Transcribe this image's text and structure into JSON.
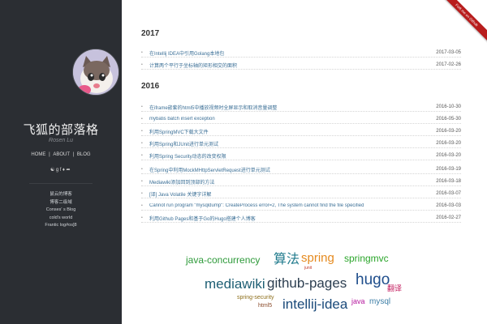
{
  "sidebar": {
    "title": "飞狐的部落格",
    "subtitle": "Rosen Lu",
    "nav": [
      "HOME",
      "ABOUT",
      "BLOG"
    ],
    "social_icons": [
      "github-icon",
      "google-plus-icon",
      "facebook-icon",
      "twitter-icon",
      "share-icon"
    ],
    "links": [
      "鼠云的博客",
      "博客二级域",
      "Conses' s Blog",
      "cold's world",
      "Frantic log#os]8"
    ]
  },
  "ribbon": {
    "label": "Fork me on Github"
  },
  "years": [
    {
      "year": "2017",
      "posts": [
        {
          "title": "在Intellij IDEA中引用Golang本地包",
          "date": "2017-03-05"
        },
        {
          "title": "计算两个平行于坐标轴的矩形相交的面积",
          "date": "2017-02-26"
        }
      ]
    },
    {
      "year": "2016",
      "posts": [
        {
          "title": "在iframe嵌套的html5中播放视频时全屏显示和取消音量调整",
          "date": "2016-10-30"
        },
        {
          "title": "mybatis batch insert exception",
          "date": "2016-05-30"
        },
        {
          "title": "利用SpringMVC下载大文件",
          "date": "2016-03-20"
        },
        {
          "title": "利用Spring和JUnit进行单元测试",
          "date": "2016-03-20"
        },
        {
          "title": "利用Spring Security动态的改变权限",
          "date": "2016-03-20"
        },
        {
          "title": "在Spring中利用MockMHttpServletRequest进行单元测试",
          "date": "2016-03-19"
        },
        {
          "title": "Mediawiki添加回到顶部的方法",
          "date": "2016-03-18"
        },
        {
          "title": "[译] Java Volatile 关键字详解",
          "date": "2016-03-07"
        },
        {
          "title": "Cannot run program \"mysqldump\": CreateProcess error=2, The system cannot find the file specified",
          "date": "2016-03-03"
        },
        {
          "title": "利用Github Pages和基于Go的Hugo搭建个人博客",
          "date": "2016-02-27"
        }
      ]
    }
  ],
  "tags": [
    {
      "text": "java-concurrency",
      "color": "#2e9a3a"
    },
    {
      "text": "算法",
      "color": "#1f7a8c"
    },
    {
      "text": "spring",
      "color": "#e58a1f"
    },
    {
      "text": "springmvc",
      "color": "#2aa52a"
    },
    {
      "text": "junit",
      "color": "#c0392b"
    },
    {
      "text": "mediawiki",
      "color": "#1e5f74"
    },
    {
      "text": "github-pages",
      "color": "#2c3e50"
    },
    {
      "text": "hugo",
      "color": "#1f4e8c"
    },
    {
      "text": "翻译",
      "color": "#c2185b"
    },
    {
      "text": "spring-security",
      "color": "#8d6e1a"
    },
    {
      "text": "html5",
      "color": "#8a4b2a"
    },
    {
      "text": "intellij-idea",
      "color": "#1a4a7a"
    },
    {
      "text": "java",
      "color": "#b5179e"
    },
    {
      "text": "mysql",
      "color": "#3d7ea6"
    }
  ]
}
